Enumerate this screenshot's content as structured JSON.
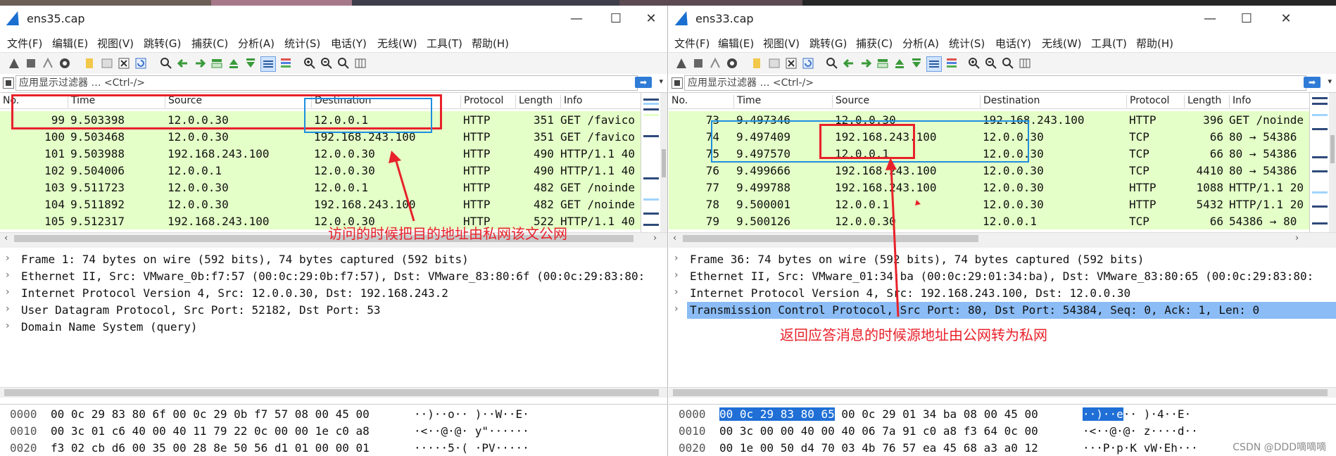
{
  "left": {
    "title": "ens35.cap",
    "window_controls": {
      "minimize": "—",
      "maximize": "☐",
      "close": "✕"
    },
    "menu": [
      "文件(F)",
      "编辑(E)",
      "视图(V)",
      "跳转(G)",
      "捕获(C)",
      "分析(A)",
      "统计(S)",
      "电话(Y)",
      "无线(W)",
      "工具(T)",
      "帮助(H)"
    ],
    "filter_placeholder": "应用显示过滤器 … <Ctrl-/>",
    "columns": [
      "No.",
      "Time",
      "Source",
      "Destination",
      "Protocol",
      "Length",
      "Info"
    ],
    "packets": [
      {
        "no": "99",
        "time": "9.503398",
        "src": "12.0.0.30",
        "dst": "12.0.0.1",
        "proto": "HTTP",
        "len": "351",
        "info": "GET /favico"
      },
      {
        "no": "100",
        "time": "9.503468",
        "src": "12.0.0.30",
        "dst": "192.168.243.100",
        "proto": "HTTP",
        "len": "351",
        "info": "GET /favico"
      },
      {
        "no": "101",
        "time": "9.503988",
        "src": "192.168.243.100",
        "dst": "12.0.0.30",
        "proto": "HTTP",
        "len": "490",
        "info": "HTTP/1.1 40"
      },
      {
        "no": "102",
        "time": "9.504006",
        "src": "12.0.0.1",
        "dst": "12.0.0.30",
        "proto": "HTTP",
        "len": "490",
        "info": "HTTP/1.1 40"
      },
      {
        "no": "103",
        "time": "9.511723",
        "src": "12.0.0.30",
        "dst": "12.0.0.1",
        "proto": "HTTP",
        "len": "482",
        "info": "GET /noinde"
      },
      {
        "no": "104",
        "time": "9.511892",
        "src": "12.0.0.30",
        "dst": "192.168.243.100",
        "proto": "HTTP",
        "len": "482",
        "info": "GET /noinde"
      },
      {
        "no": "105",
        "time": "9.512317",
        "src": "192.168.243.100",
        "dst": "12.0.0.30",
        "proto": "HTTP",
        "len": "522",
        "info": "HTTP/1.1 40"
      }
    ],
    "details": [
      "Frame 1: 74 bytes on wire (592 bits), 74 bytes captured (592 bits)",
      "Ethernet II, Src: VMware_0b:f7:57 (00:0c:29:0b:f7:57), Dst: VMware_83:80:6f (00:0c:29:83:80:",
      "Internet Protocol Version 4, Src: 12.0.0.30, Dst: 192.168.243.2",
      "User Datagram Protocol, Src Port: 52182, Dst Port: 53",
      "Domain Name System (query)"
    ],
    "bytes": [
      {
        "off": "0000",
        "hex": "00 0c 29 83 80 6f 00 0c  29 0b f7 57 08 00 45 00",
        "ascii": "··)··o·· )··W··E·"
      },
      {
        "off": "0010",
        "hex": "00 3c 01 c6 40 00 40 11  79 22 0c 00 00 1e c0 a8",
        "ascii": "·<··@·@· y\"······"
      },
      {
        "off": "0020",
        "hex": "f3 02 cb d6 00 35 00 28  8e 50 56 d1 01 00 00 01",
        "ascii": "·····5·( ·PV·····"
      }
    ],
    "annotation": "访问的时候把目的地址由私网该文公网"
  },
  "right": {
    "title": "ens33.cap",
    "window_controls": {
      "minimize": "—",
      "maximize": "☐",
      "close": "✕"
    },
    "menu": [
      "文件(F)",
      "编辑(E)",
      "视图(V)",
      "跳转(G)",
      "捕获(C)",
      "分析(A)",
      "统计(S)",
      "电话(Y)",
      "无线(W)",
      "工具(T)",
      "帮助(H)"
    ],
    "filter_placeholder": "应用显示过滤器 … <Ctrl-/>",
    "columns": [
      "No.",
      "Time",
      "Source",
      "Destination",
      "Protocol",
      "Length",
      "Info"
    ],
    "packets": [
      {
        "no": "73",
        "time": "9.497346",
        "src": "12.0.0.30",
        "dst": "192.168.243.100",
        "proto": "HTTP",
        "len": "396",
        "info": "GET /noinde"
      },
      {
        "no": "74",
        "time": "9.497409",
        "src": "192.168.243.100",
        "dst": "12.0.0.30",
        "proto": "TCP",
        "len": "66",
        "info": "80 → 54386"
      },
      {
        "no": "75",
        "time": "9.497570",
        "src": "12.0.0.1",
        "dst": "12.0.0.30",
        "proto": "TCP",
        "len": "66",
        "info": "80 → 54386"
      },
      {
        "no": "76",
        "time": "9.499666",
        "src": "192.168.243.100",
        "dst": "12.0.0.30",
        "proto": "TCP",
        "len": "4410",
        "info": "80 → 54386"
      },
      {
        "no": "77",
        "time": "9.499788",
        "src": "192.168.243.100",
        "dst": "12.0.0.30",
        "proto": "HTTP",
        "len": "1088",
        "info": "HTTP/1.1 20"
      },
      {
        "no": "78",
        "time": "9.500001",
        "src": "12.0.0.1",
        "dst": "12.0.0.30",
        "proto": "HTTP",
        "len": "5432",
        "info": "HTTP/1.1 20"
      },
      {
        "no": "79",
        "time": "9.500126",
        "src": "12.0.0.30",
        "dst": "12.0.0.1",
        "proto": "TCP",
        "len": "66",
        "info": "54386 → 80"
      }
    ],
    "details": [
      "Frame 36: 74 bytes on wire (592 bits), 74 bytes captured (592 bits)",
      "Ethernet II, Src: VMware_01:34:ba (00:0c:29:01:34:ba), Dst: VMware_83:80:65 (00:0c:29:83:80:",
      "Internet Protocol Version 4, Src: 192.168.243.100, Dst: 12.0.0.30",
      "Transmission Control Protocol, Src Port: 80, Dst Port: 54384, Seq: 0, Ack: 1, Len: 0"
    ],
    "bytes": [
      {
        "off": "0000",
        "hex_hl": "00 0c 29 83 80 65",
        "hex": " 00 0c  29 01 34 ba 08 00 45 00",
        "ascii_hl": "··)··e",
        "ascii": "·· )·4··E·"
      },
      {
        "off": "0010",
        "hex": "00 3c 00 00 40 00 40 06  7a 91 c0 a8 f3 64 0c 00",
        "ascii": "·<··@·@· z····d··"
      },
      {
        "off": "0020",
        "hex": "00 1e 00 50 d4 70 03 4b  76 57 ea 45 68 a3 a0 12",
        "ascii": "···P·p·K vW·Eh···"
      }
    ],
    "annotation": "返回应答消息的时候源地址由公网转为私网"
  },
  "watermark": "CSDN @DDD嘀嘀嘀",
  "colors": {
    "row_bg": "#e4ffc7",
    "annotation_red": "#e8212a",
    "annotation_blue": "#1d8ee0",
    "selected_row": "#8bbcf5"
  }
}
